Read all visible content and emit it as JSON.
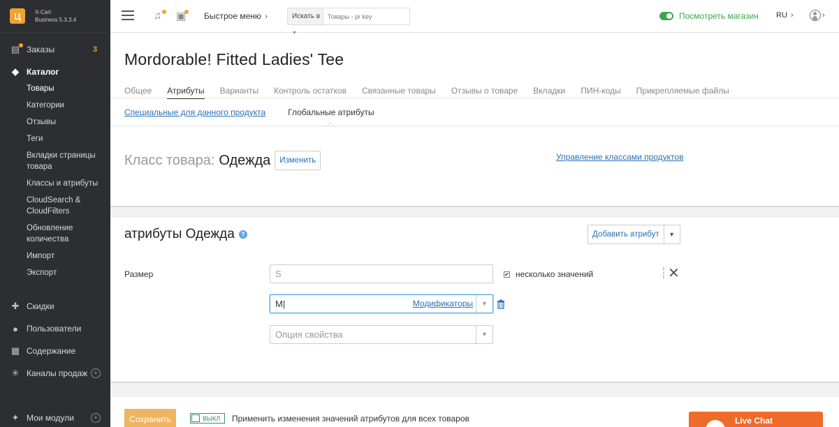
{
  "app": {
    "brand": "X-Cart",
    "version": "Business 5.3.3.4",
    "logo_glyph": "Ц"
  },
  "colors": {
    "sidebar_bg": "#2d2e31",
    "accent": "#f0a330",
    "link": "#2a6fb5",
    "store_green": "#3ca54a",
    "livechat": "#ef6b2a"
  },
  "sidebar": {
    "orders": {
      "label": "Заказы",
      "count": "3",
      "icon": "orders-icon"
    },
    "catalog": {
      "label": "Каталог",
      "icon": "tags-icon"
    },
    "catalog_sub": [
      "Товары",
      "Категории",
      "Отзывы",
      "Теги",
      "Вкладки страницы товара",
      "Классы и атрибуты",
      "CloudSearch & CloudFilters",
      "Обновление количества",
      "Импорт",
      "Экспорт"
    ],
    "discounts": {
      "label": "Скидки",
      "icon": "gift-icon"
    },
    "users": {
      "label": "Пользователи",
      "icon": "users-icon"
    },
    "content": {
      "label": "Содержание",
      "icon": "content-icon"
    },
    "channels": {
      "label": "Каналы продаж",
      "icon": "asterisk-icon"
    },
    "modules": {
      "label": "Мои модули",
      "icon": "puzzle-icon"
    }
  },
  "topbar": {
    "quick_menu": "Быстрое меню",
    "search_in": "Искать в",
    "search_placeholder": "Товары - pr key",
    "view_store": "Посмотреть магазин",
    "lang": "RU"
  },
  "page": {
    "title": "Mordorable! Fitted Ladies' Tee",
    "tabs": [
      "Общее",
      "Атрибуты",
      "Варианты",
      "Контроль остатков",
      "Связанные товары",
      "Отзывы о товаре",
      "Вкладки",
      "ПИН-коды",
      "Прикрепляемые файлы"
    ],
    "active_tab_index": 1,
    "subtabs": {
      "product_specific": "Специальные для данного продукта",
      "global": "Глобальные атрибуты"
    },
    "class_label": "Класс товара:",
    "class_value": "Одежда",
    "change_button": "Изменить",
    "manage_classes": "Управление классами продуктов"
  },
  "attributes": {
    "section_title": "атрибуты Одежда",
    "help_glyph": "?",
    "add_button": "Добавить атрибут",
    "attr_name": "Размер",
    "value_1": "S",
    "value_2": "M",
    "modifiers": "Модификаторы",
    "option_placeholder": "Опция свойства",
    "multiple_values": "несколько значений",
    "multiple_checked": true
  },
  "footer": {
    "save": "Сохранить",
    "toggle_state": "ВЫКЛ",
    "apply_text": "Применить изменения значений атрибутов для всех товаров",
    "livechat": "Live Chat"
  }
}
